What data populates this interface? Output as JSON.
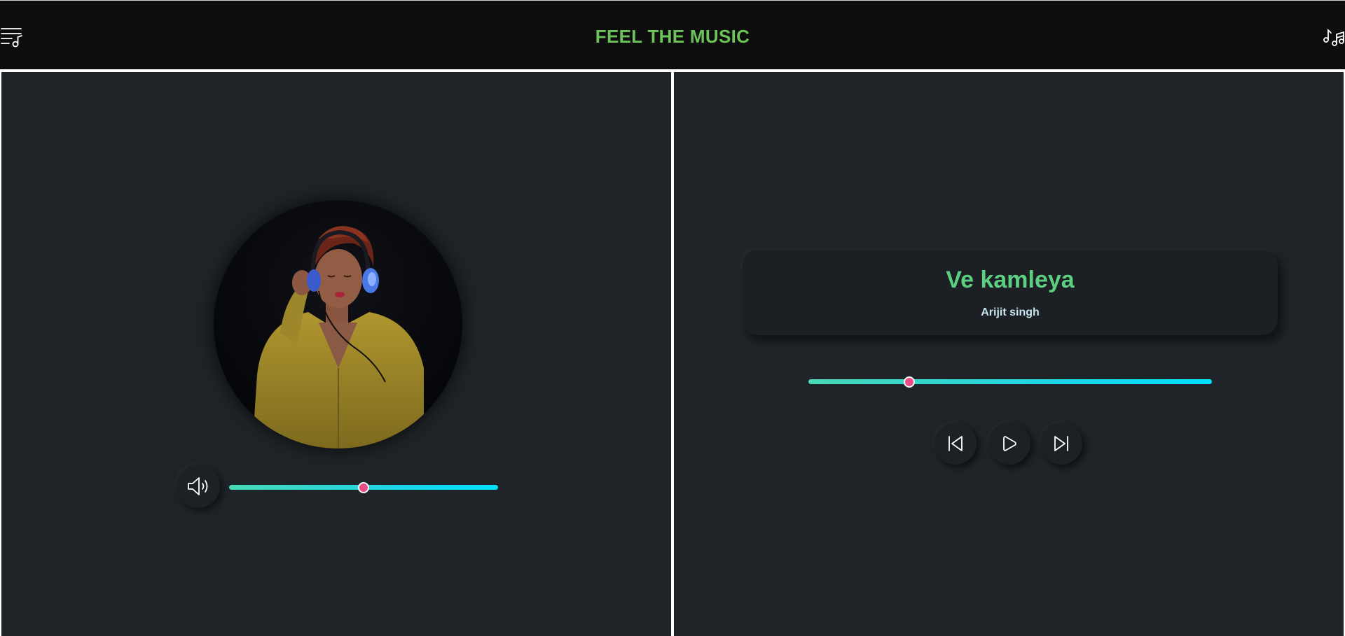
{
  "header": {
    "title": "FEEL THE MUSIC",
    "menu_icon": "playlist-menu-icon",
    "right_icon": "music-notes-icon"
  },
  "player": {
    "album_art": "woman-with-headphones-photo",
    "song_title": "Ve kamleya",
    "artist": "Arijit singh",
    "volume_level": 0.5,
    "progress_level": 0.25,
    "controls": [
      "previous",
      "play",
      "next"
    ]
  },
  "colors": {
    "accent_title": "#6cc35a",
    "song_title": "#5ccf80",
    "artist_text": "#c5e4ee",
    "slider_start": "#48d9b5",
    "slider_end": "#00e0ff",
    "thumb": "#e94f86",
    "background": "#1f2428",
    "header_bg": "#0d0d0d"
  }
}
